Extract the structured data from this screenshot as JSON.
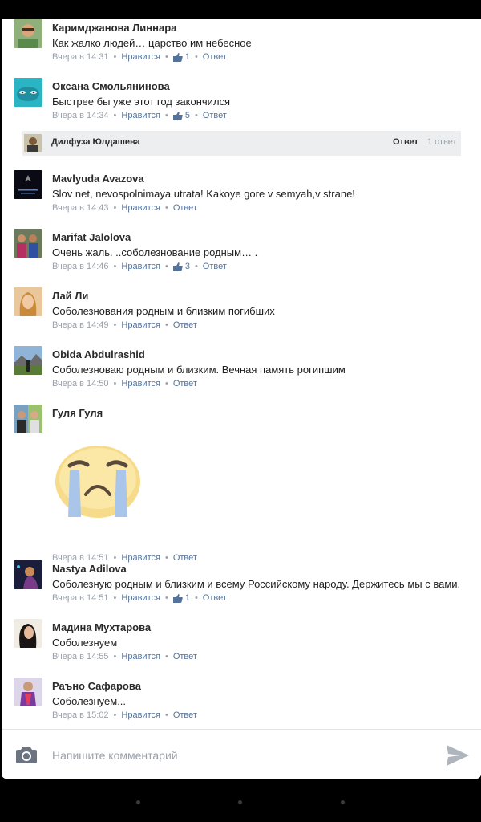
{
  "colors": {
    "link": "#55739a",
    "meta": "#9aa1a9",
    "author": "#2a2a2a",
    "panel": "#ffffff"
  },
  "labels": {
    "like": "Нравится",
    "reply": "Ответ",
    "separator": "•"
  },
  "comments": [
    {
      "author": "Каримджанова Линнара",
      "text": "Как жалко людей…  царство им небесное",
      "time": "Вчера в 14:31",
      "likes": "1"
    },
    {
      "author": "Оксана Смольянинова",
      "text": "Быстрее бы уже этот год закончился",
      "time": "Вчера в 14:34",
      "likes": "5"
    },
    {
      "author": "Mavlyuda Avazova",
      "text": "Slov net, nevospolnimaya utrata! Kakoye gore v semyah,v strane!",
      "time": "Вчера в 14:43",
      "likes": ""
    },
    {
      "author": "Marifat Jalolova",
      "text": "Очень жаль. ..соболезнование родным… .",
      "time": "Вчера в 14:46",
      "likes": "3"
    },
    {
      "author": "Лай Ли",
      "text": "Соболезнования родным и близким погибших",
      "time": "Вчера в 14:49",
      "likes": ""
    },
    {
      "author": "Obida Abdulrashid",
      "text": "Соболезноваю родным и близким.  Вечная память рогипшим",
      "time": "Вчера в 14:50",
      "likes": ""
    },
    {
      "author": "Гуля Гуля",
      "text": "",
      "time": "Вчера в 14:51",
      "likes": "",
      "sticker": "crying-face"
    },
    {
      "author": "Nastya Adilova",
      "text": "Соболезную родным и близким и всему Российскому народу. Держитесь мы с вами.",
      "time": "Вчера в 14:51",
      "likes": "1"
    },
    {
      "author": "Мадина Мухтарова",
      "text": "Соболезнуем",
      "time": "Вчера в 14:55",
      "likes": ""
    },
    {
      "author": "Раъно Сафарова",
      "text": "Соболезнуем...",
      "time": "Вчера в 15:02",
      "likes": ""
    }
  ],
  "thread": {
    "author": "Дилфуза Юлдашева",
    "reply_label": "Ответ",
    "count": "1 ответ"
  },
  "composer": {
    "placeholder": "Напишите комментарий",
    "camera_icon": "camera-icon",
    "send_icon": "send-icon"
  }
}
